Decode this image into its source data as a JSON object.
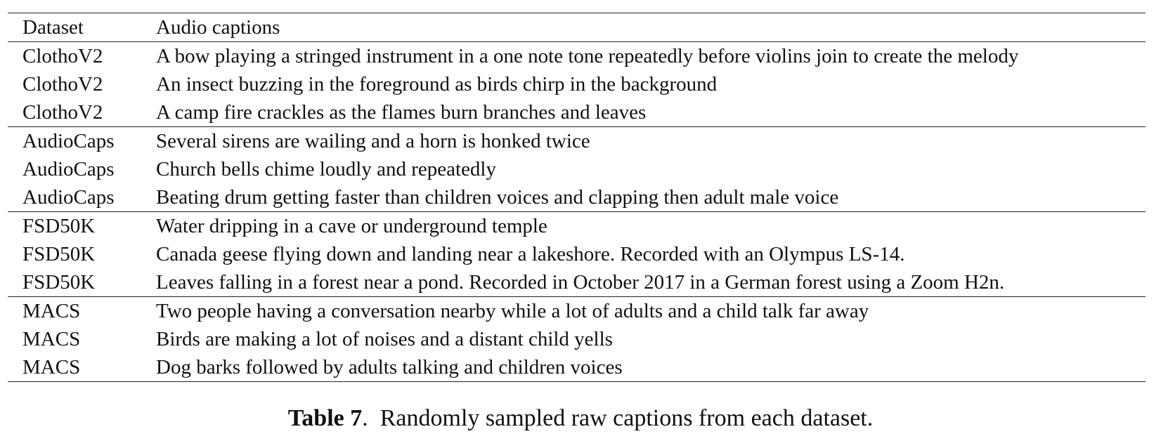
{
  "table": {
    "headers": [
      "Dataset",
      "Audio captions"
    ],
    "groups": [
      {
        "rows": [
          [
            "ClothoV2",
            "A bow playing a stringed instrument in a one note tone repeatedly before violins join to create the melody"
          ],
          [
            "ClothoV2",
            "An insect buzzing in the foreground as birds chirp in the background"
          ],
          [
            "ClothoV2",
            "A camp fire crackles as the flames burn branches and leaves"
          ]
        ]
      },
      {
        "rows": [
          [
            "AudioCaps",
            "Several sirens are wailing and a horn is honked twice"
          ],
          [
            "AudioCaps",
            "Church bells chime loudly and repeatedly"
          ],
          [
            "AudioCaps",
            "Beating drum getting faster than children voices and clapping then adult male voice"
          ]
        ]
      },
      {
        "rows": [
          [
            "FSD50K",
            "Water dripping in a cave or underground temple"
          ],
          [
            "FSD50K",
            "Canada geese flying down and landing near a lakeshore. Recorded with an Olympus LS-14."
          ],
          [
            "FSD50K",
            "Leaves falling in a forest near a pond. Recorded in October 2017 in a German forest using a Zoom H2n."
          ]
        ]
      },
      {
        "rows": [
          [
            "MACS",
            "Two people having a conversation nearby while a lot of adults and a child talk far away"
          ],
          [
            "MACS",
            "Birds are making a lot of noises and a distant child yells"
          ],
          [
            "MACS",
            "Dog barks followed by adults talking and children voices"
          ]
        ]
      }
    ]
  },
  "caption": {
    "label": "Table 7",
    "separator": ".",
    "text": "Randomly sampled raw captions from each dataset."
  }
}
